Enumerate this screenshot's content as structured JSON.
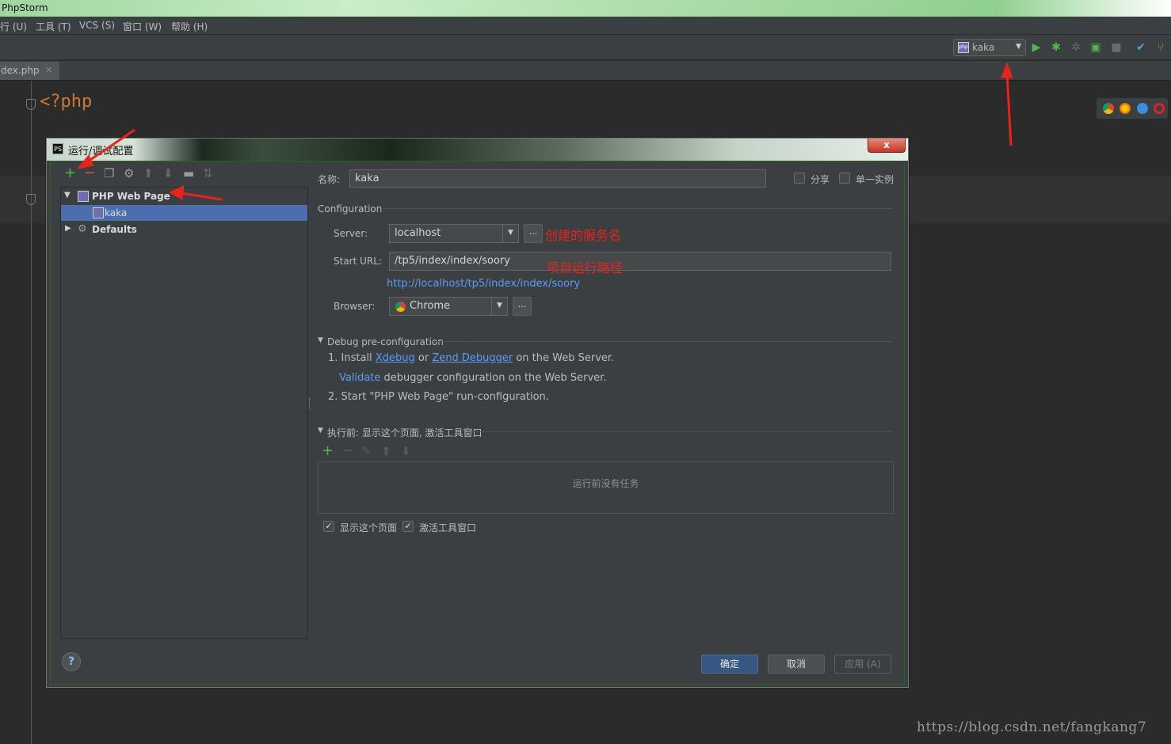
{
  "window": {
    "title": "PhpStorm"
  },
  "menu": {
    "items": [
      "行 (U)",
      "工具 (T)",
      "VCS (S)",
      "窗口 (W)",
      "帮助 (H)"
    ]
  },
  "toolbar": {
    "run_config": "kaka"
  },
  "editor": {
    "tab_name": "dex.php",
    "code": "<?php"
  },
  "dialog": {
    "title": "运行/调试配置",
    "close_label": "x",
    "tree": {
      "group": "PHP Web Page",
      "child": "kaka",
      "defaults": "Defaults"
    },
    "name_label": "名称:",
    "name_value": "kaka",
    "share_label": "分享",
    "single_instance_label": "单一实例",
    "section_config": "Configuration",
    "server_label": "Server:",
    "server_value": "localhost",
    "start_url_label": "Start URL:",
    "start_url_value": "/tp5/index/index/soory",
    "resolved_url": "http://localhost/tp5/index/index/soory",
    "browser_label": "Browser:",
    "browser_value": "Chrome",
    "dots": "...",
    "debug_section": "Debug pre-configuration",
    "debug_step1_prefix": "1. Install",
    "xdebug_link": "Xdebug",
    "or": "or",
    "zend_link": "Zend Debugger",
    "debug_step1_suffix": "on the Web Server.",
    "validate_link": "Validate",
    "validate_suffix": "debugger configuration on the Web Server.",
    "debug_step2": "2. Start \"PHP Web Page\" run-configuration.",
    "before_launch_section": "执行前: 显示这个页面, 激活工具窗口",
    "no_tasks": "运行前没有任务",
    "show_page_label": "显示这个页面",
    "activate_tool_label": "激活工具窗口",
    "ok_label": "确定",
    "cancel_label": "取消",
    "apply_label": "应用 (A)",
    "help": "?"
  },
  "annotations": {
    "server_note": "创建的服务名",
    "url_note": "项目运行路径"
  },
  "watermark": "https://blog.csdn.net/fangkang7",
  "colors": {
    "accent_selection": "#4b6eaf",
    "link": "#589df6",
    "annotation_red": "#e8231e",
    "run_green": "#4fb848"
  }
}
